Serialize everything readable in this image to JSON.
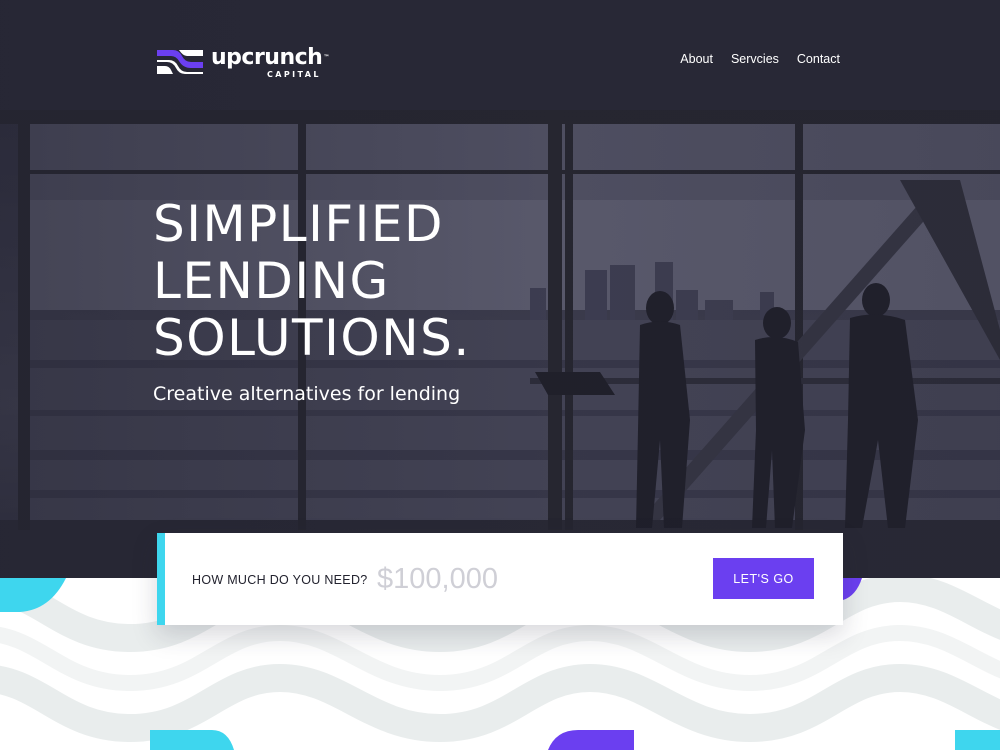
{
  "brand": {
    "name": "upcrunch",
    "trademark": "™",
    "subtitle": "CAPITAL"
  },
  "nav": {
    "items": [
      {
        "label": "About"
      },
      {
        "label": "Servcies"
      },
      {
        "label": "Contact"
      }
    ]
  },
  "hero": {
    "headline_lines": [
      "SIMPLIFIED",
      "LENDING",
      "SOLUTIONS."
    ],
    "subheadline": "Creative alternatives for lending"
  },
  "loan_form": {
    "label": "HOW MUCH DO YOU NEED?",
    "amount_placeholder": "$100,000",
    "submit_label": "LET'S GO"
  },
  "colors": {
    "accent_purple": "#6b3ff0",
    "accent_cyan": "#3ed6ee",
    "hero_overlay": "#2c2c3c",
    "wave_gray": "#e9eded"
  },
  "icons": {
    "logo_mark": "stacked-wave-mark"
  }
}
